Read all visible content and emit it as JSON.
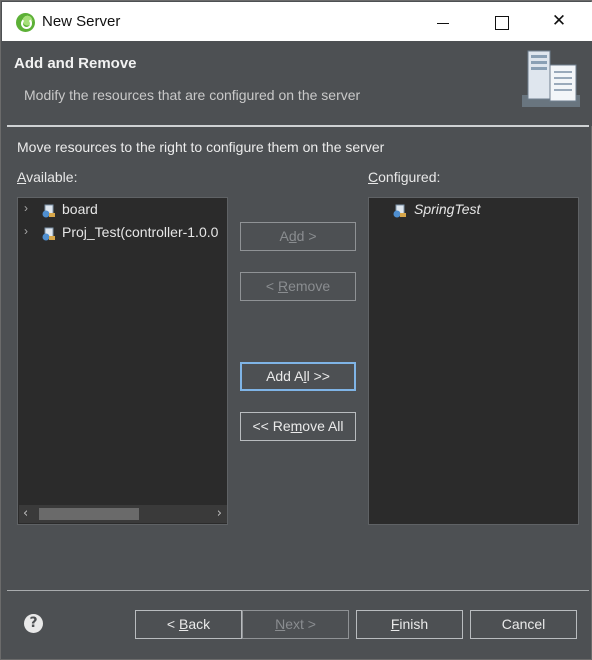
{
  "window": {
    "title": "New Server",
    "controls": {
      "minimize": "",
      "maximize": "",
      "close": "✕"
    }
  },
  "header": {
    "title": "Add and Remove",
    "description": "Modify the resources that are configured on the server",
    "icon": "server-icon"
  },
  "instruction": "Move resources to the right to configure them on the server",
  "available": {
    "label_mnemonic": "A",
    "label_rest": "vailable:",
    "items": [
      {
        "label": "board",
        "icon": "web-project-icon",
        "expandable": true
      },
      {
        "label": "Proj_Test(controller-1.0.0",
        "icon": "web-project-icon",
        "expandable": true
      }
    ]
  },
  "configured": {
    "label_mnemonic": "C",
    "label_rest": "onfigured:",
    "items": [
      {
        "label": "SpringTest",
        "icon": "web-project-icon",
        "italic": true
      }
    ]
  },
  "buttons": {
    "add": {
      "pre": "A",
      "mn": "d",
      "post": "d >",
      "enabled": false
    },
    "remove": {
      "pre": "< ",
      "mn": "R",
      "post": "emove",
      "enabled": false
    },
    "add_all": {
      "pre": "Add A",
      "mn": "l",
      "post": "l >>",
      "enabled": true,
      "focused": true
    },
    "remove_all": {
      "pre": "<< Re",
      "mn": "m",
      "post": "ove All",
      "enabled": true
    }
  },
  "footer": {
    "help_icon": "help-icon",
    "back": {
      "pre": "< ",
      "mn": "B",
      "post": "ack",
      "enabled": true
    },
    "next": {
      "pre": "",
      "mn": "N",
      "post": "ext >",
      "enabled": false
    },
    "finish": {
      "pre": "",
      "mn": "F",
      "post": "inish",
      "enabled": true
    },
    "cancel": "Cancel"
  },
  "colors": {
    "window_bg": "#4d5053",
    "list_bg": "#2b2b2b",
    "focus_border": "#7fb4e6"
  }
}
